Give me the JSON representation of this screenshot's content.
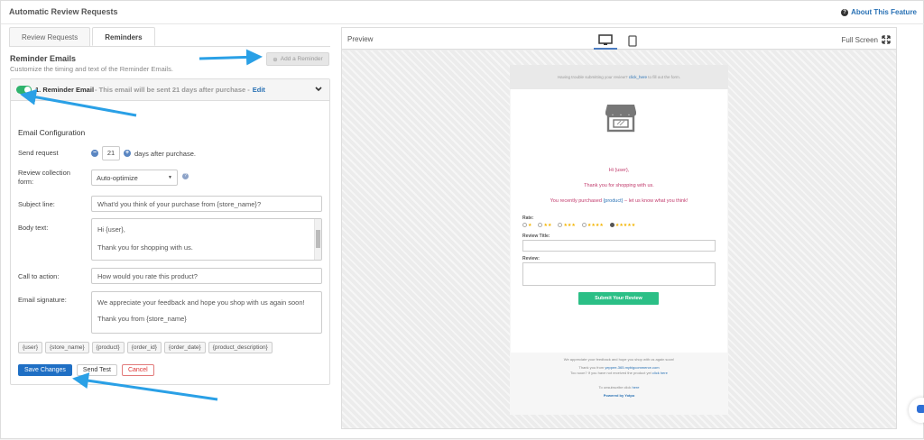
{
  "header": {
    "title": "Automatic Review Requests",
    "about_label": "About This Feature",
    "about_icon": "question-circle-icon"
  },
  "tabs": [
    {
      "label": "Review Requests",
      "active": false
    },
    {
      "label": "Reminders",
      "active": true
    }
  ],
  "reminders": {
    "heading": "Reminder Emails",
    "subtitle": "Customize the timing and text of the Reminder Emails.",
    "add_button": "Add a Reminder"
  },
  "reminder_card": {
    "title": "1. Reminder Email",
    "description": "- This email will be sent 21 days after purchase -",
    "edit_label": "Edit",
    "enabled": true
  },
  "config": {
    "heading": "Email Configuration",
    "send_request_label": "Send request",
    "days_value": "21",
    "days_suffix": "days after purchase.",
    "review_form_label": "Review collection form:",
    "review_form_value": "Auto-optimize",
    "subject_label": "Subject line:",
    "subject_value": "What'd you think of your purchase from {store_name}?",
    "body_label": "Body text:",
    "body_line1": "Hi {user},",
    "body_line2": "Thank you for shopping with us.",
    "cta_label": "Call to action:",
    "cta_value": "How would you rate this product?",
    "signature_label": "Email signature:",
    "signature_line1": "We appreciate your feedback and hope you shop with us again soon!",
    "signature_line2": "Thank you from {store_name}"
  },
  "variables": [
    "{user}",
    "{store_name}",
    "{product}",
    "{order_id}",
    "{order_date}",
    "{product_description}"
  ],
  "actions": {
    "save": "Save Changes",
    "test": "Send Test",
    "cancel": "Cancel"
  },
  "preview": {
    "label": "Preview",
    "fullscreen_label": "Full Screen",
    "email": {
      "top_text_pre": "Having trouble submitting your review?",
      "top_link": "click_here",
      "top_text_post": "to fill out the form.",
      "greeting": "Hi {user},",
      "thanks": "Thank you for shopping with us.",
      "purchased_pre": "You recently purchased",
      "purchased_product": "{product}",
      "purchased_post": "– let us know what you think!",
      "rate_label": "Rate:",
      "review_title_label": "Review Title:",
      "review_label": "Review:",
      "submit_label": "Submit Your Review",
      "footer_line1": "We appreciate your feedback and hope you shop with us again soon!",
      "footer_line2_pre": "Thank you from",
      "footer_line2_link": "yeppee-365.mybigcommerce.com",
      "footer_line3_pre": "Too soon? If you have not received the product yet",
      "footer_line3_link": "click here",
      "unsubscribe_pre": "To unsubscribe click",
      "unsubscribe_link": "here",
      "powered_by": "Powered by Yotpo"
    }
  },
  "colors": {
    "accent": "#1f6fc4",
    "toggle_on": "#2fb36d",
    "submit": "#2bbf86",
    "email_text": "#c0396b",
    "annotation_arrow": "#2aa0e6"
  }
}
